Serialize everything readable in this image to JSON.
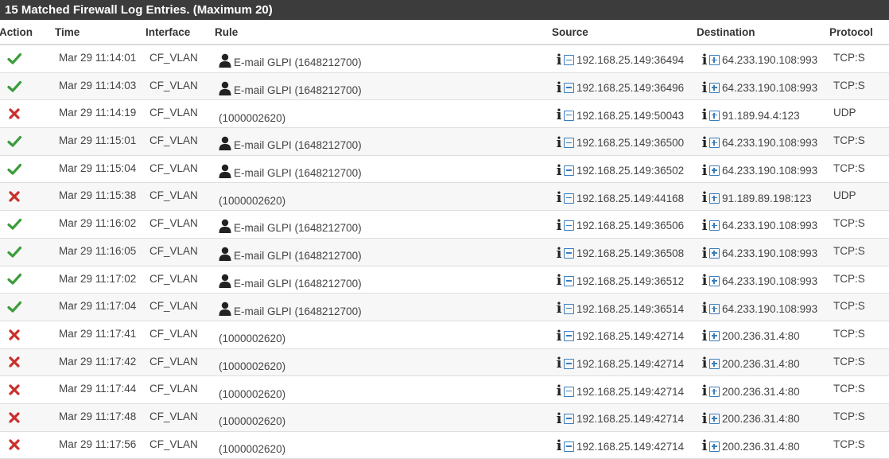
{
  "panel": {
    "title": "15 Matched Firewall Log Entries. (Maximum 20)"
  },
  "headers": {
    "action": "Action",
    "time": "Time",
    "interface": "Interface",
    "rule": "Rule",
    "source": "Source",
    "destination": "Destination",
    "protocol": "Protocol"
  },
  "colors": {
    "pass": "#3c9d3c",
    "block": "#c9302c",
    "header_bg": "#3c3c3c",
    "link": "#3a7dbd"
  },
  "icons": {
    "pass": "check-icon",
    "block": "times-icon",
    "user": "user-icon",
    "info": "info-icon",
    "remove": "minus-square-icon",
    "add": "plus-square-icon"
  },
  "rows": [
    {
      "action": "pass",
      "time": "Mar 29 11:14:01",
      "interface": "CF_VLAN",
      "rule": "E-mail GLPI (1648212700)",
      "user": true,
      "source": "192.168.25.149:36494",
      "destination": "64.233.190.108:993",
      "protocol": "TCP:S"
    },
    {
      "action": "pass",
      "time": "Mar 29 11:14:03",
      "interface": "CF_VLAN",
      "rule": "E-mail GLPI (1648212700)",
      "user": true,
      "source": "192.168.25.149:36496",
      "destination": "64.233.190.108:993",
      "protocol": "TCP:S"
    },
    {
      "action": "block",
      "time": "Mar 29 11:14:19",
      "interface": "CF_VLAN",
      "rule": "(1000002620)",
      "user": false,
      "source": "192.168.25.149:50043",
      "destination": "91.189.94.4:123",
      "protocol": "UDP"
    },
    {
      "action": "pass",
      "time": "Mar 29 11:15:01",
      "interface": "CF_VLAN",
      "rule": "E-mail GLPI (1648212700)",
      "user": true,
      "source": "192.168.25.149:36500",
      "destination": "64.233.190.108:993",
      "protocol": "TCP:S"
    },
    {
      "action": "pass",
      "time": "Mar 29 11:15:04",
      "interface": "CF_VLAN",
      "rule": "E-mail GLPI (1648212700)",
      "user": true,
      "source": "192.168.25.149:36502",
      "destination": "64.233.190.108:993",
      "protocol": "TCP:S"
    },
    {
      "action": "block",
      "time": "Mar 29 11:15:38",
      "interface": "CF_VLAN",
      "rule": "(1000002620)",
      "user": false,
      "source": "192.168.25.149:44168",
      "destination": "91.189.89.198:123",
      "protocol": "UDP"
    },
    {
      "action": "pass",
      "time": "Mar 29 11:16:02",
      "interface": "CF_VLAN",
      "rule": "E-mail GLPI (1648212700)",
      "user": true,
      "source": "192.168.25.149:36506",
      "destination": "64.233.190.108:993",
      "protocol": "TCP:S"
    },
    {
      "action": "pass",
      "time": "Mar 29 11:16:05",
      "interface": "CF_VLAN",
      "rule": "E-mail GLPI (1648212700)",
      "user": true,
      "source": "192.168.25.149:36508",
      "destination": "64.233.190.108:993",
      "protocol": "TCP:S"
    },
    {
      "action": "pass",
      "time": "Mar 29 11:17:02",
      "interface": "CF_VLAN",
      "rule": "E-mail GLPI (1648212700)",
      "user": true,
      "source": "192.168.25.149:36512",
      "destination": "64.233.190.108:993",
      "protocol": "TCP:S"
    },
    {
      "action": "pass",
      "time": "Mar 29 11:17:04",
      "interface": "CF_VLAN",
      "rule": "E-mail GLPI (1648212700)",
      "user": true,
      "source": "192.168.25.149:36514",
      "destination": "64.233.190.108:993",
      "protocol": "TCP:S"
    },
    {
      "action": "block",
      "time": "Mar 29 11:17:41",
      "interface": "CF_VLAN",
      "rule": "(1000002620)",
      "user": false,
      "source": "192.168.25.149:42714",
      "destination": "200.236.31.4:80",
      "protocol": "TCP:S"
    },
    {
      "action": "block",
      "time": "Mar 29 11:17:42",
      "interface": "CF_VLAN",
      "rule": "(1000002620)",
      "user": false,
      "source": "192.168.25.149:42714",
      "destination": "200.236.31.4:80",
      "protocol": "TCP:S"
    },
    {
      "action": "block",
      "time": "Mar 29 11:17:44",
      "interface": "CF_VLAN",
      "rule": "(1000002620)",
      "user": false,
      "source": "192.168.25.149:42714",
      "destination": "200.236.31.4:80",
      "protocol": "TCP:S"
    },
    {
      "action": "block",
      "time": "Mar 29 11:17:48",
      "interface": "CF_VLAN",
      "rule": "(1000002620)",
      "user": false,
      "source": "192.168.25.149:42714",
      "destination": "200.236.31.4:80",
      "protocol": "TCP:S"
    },
    {
      "action": "block",
      "time": "Mar 29 11:17:56",
      "interface": "CF_VLAN",
      "rule": "(1000002620)",
      "user": false,
      "source": "192.168.25.149:42714",
      "destination": "200.236.31.4:80",
      "protocol": "TCP:S"
    }
  ]
}
